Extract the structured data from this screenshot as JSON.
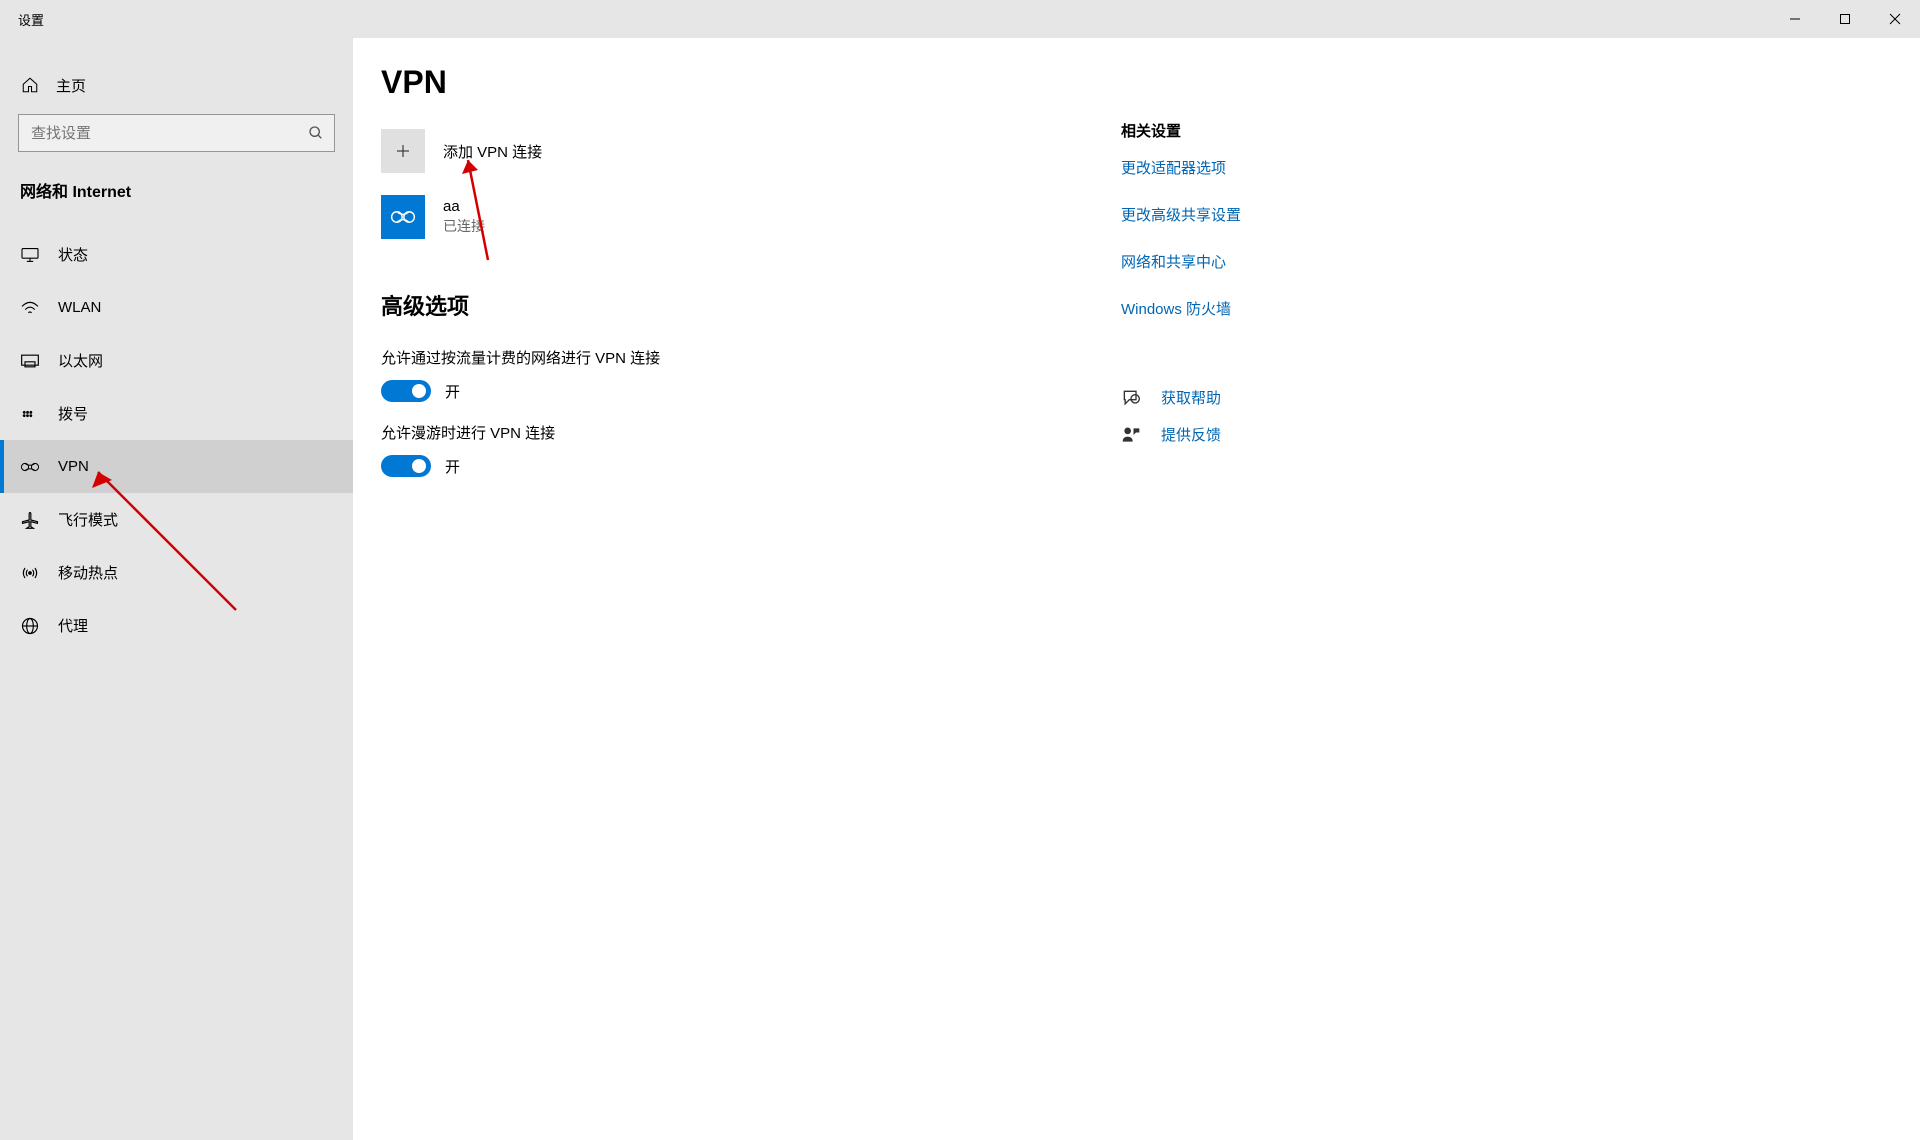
{
  "window": {
    "title": "设置"
  },
  "sidebar": {
    "home": "主页",
    "search_placeholder": "查找设置",
    "section": "网络和 Internet",
    "items": [
      {
        "label": "状态"
      },
      {
        "label": "WLAN"
      },
      {
        "label": "以太网"
      },
      {
        "label": "拨号"
      },
      {
        "label": "VPN"
      },
      {
        "label": "飞行模式"
      },
      {
        "label": "移动热点"
      },
      {
        "label": "代理"
      }
    ]
  },
  "main": {
    "title": "VPN",
    "add_label": "添加 VPN 连接",
    "connection": {
      "name": "aa",
      "status": "已连接"
    },
    "advanced_heading": "高级选项",
    "toggles": [
      {
        "label": "允许通过按流量计费的网络进行 VPN 连接",
        "state": "开"
      },
      {
        "label": "允许漫游时进行 VPN 连接",
        "state": "开"
      }
    ]
  },
  "rail": {
    "heading": "相关设置",
    "links": [
      "更改适配器选项",
      "更改高级共享设置",
      "网络和共享中心",
      "Windows 防火墙"
    ],
    "actions": [
      "获取帮助",
      "提供反馈"
    ]
  }
}
